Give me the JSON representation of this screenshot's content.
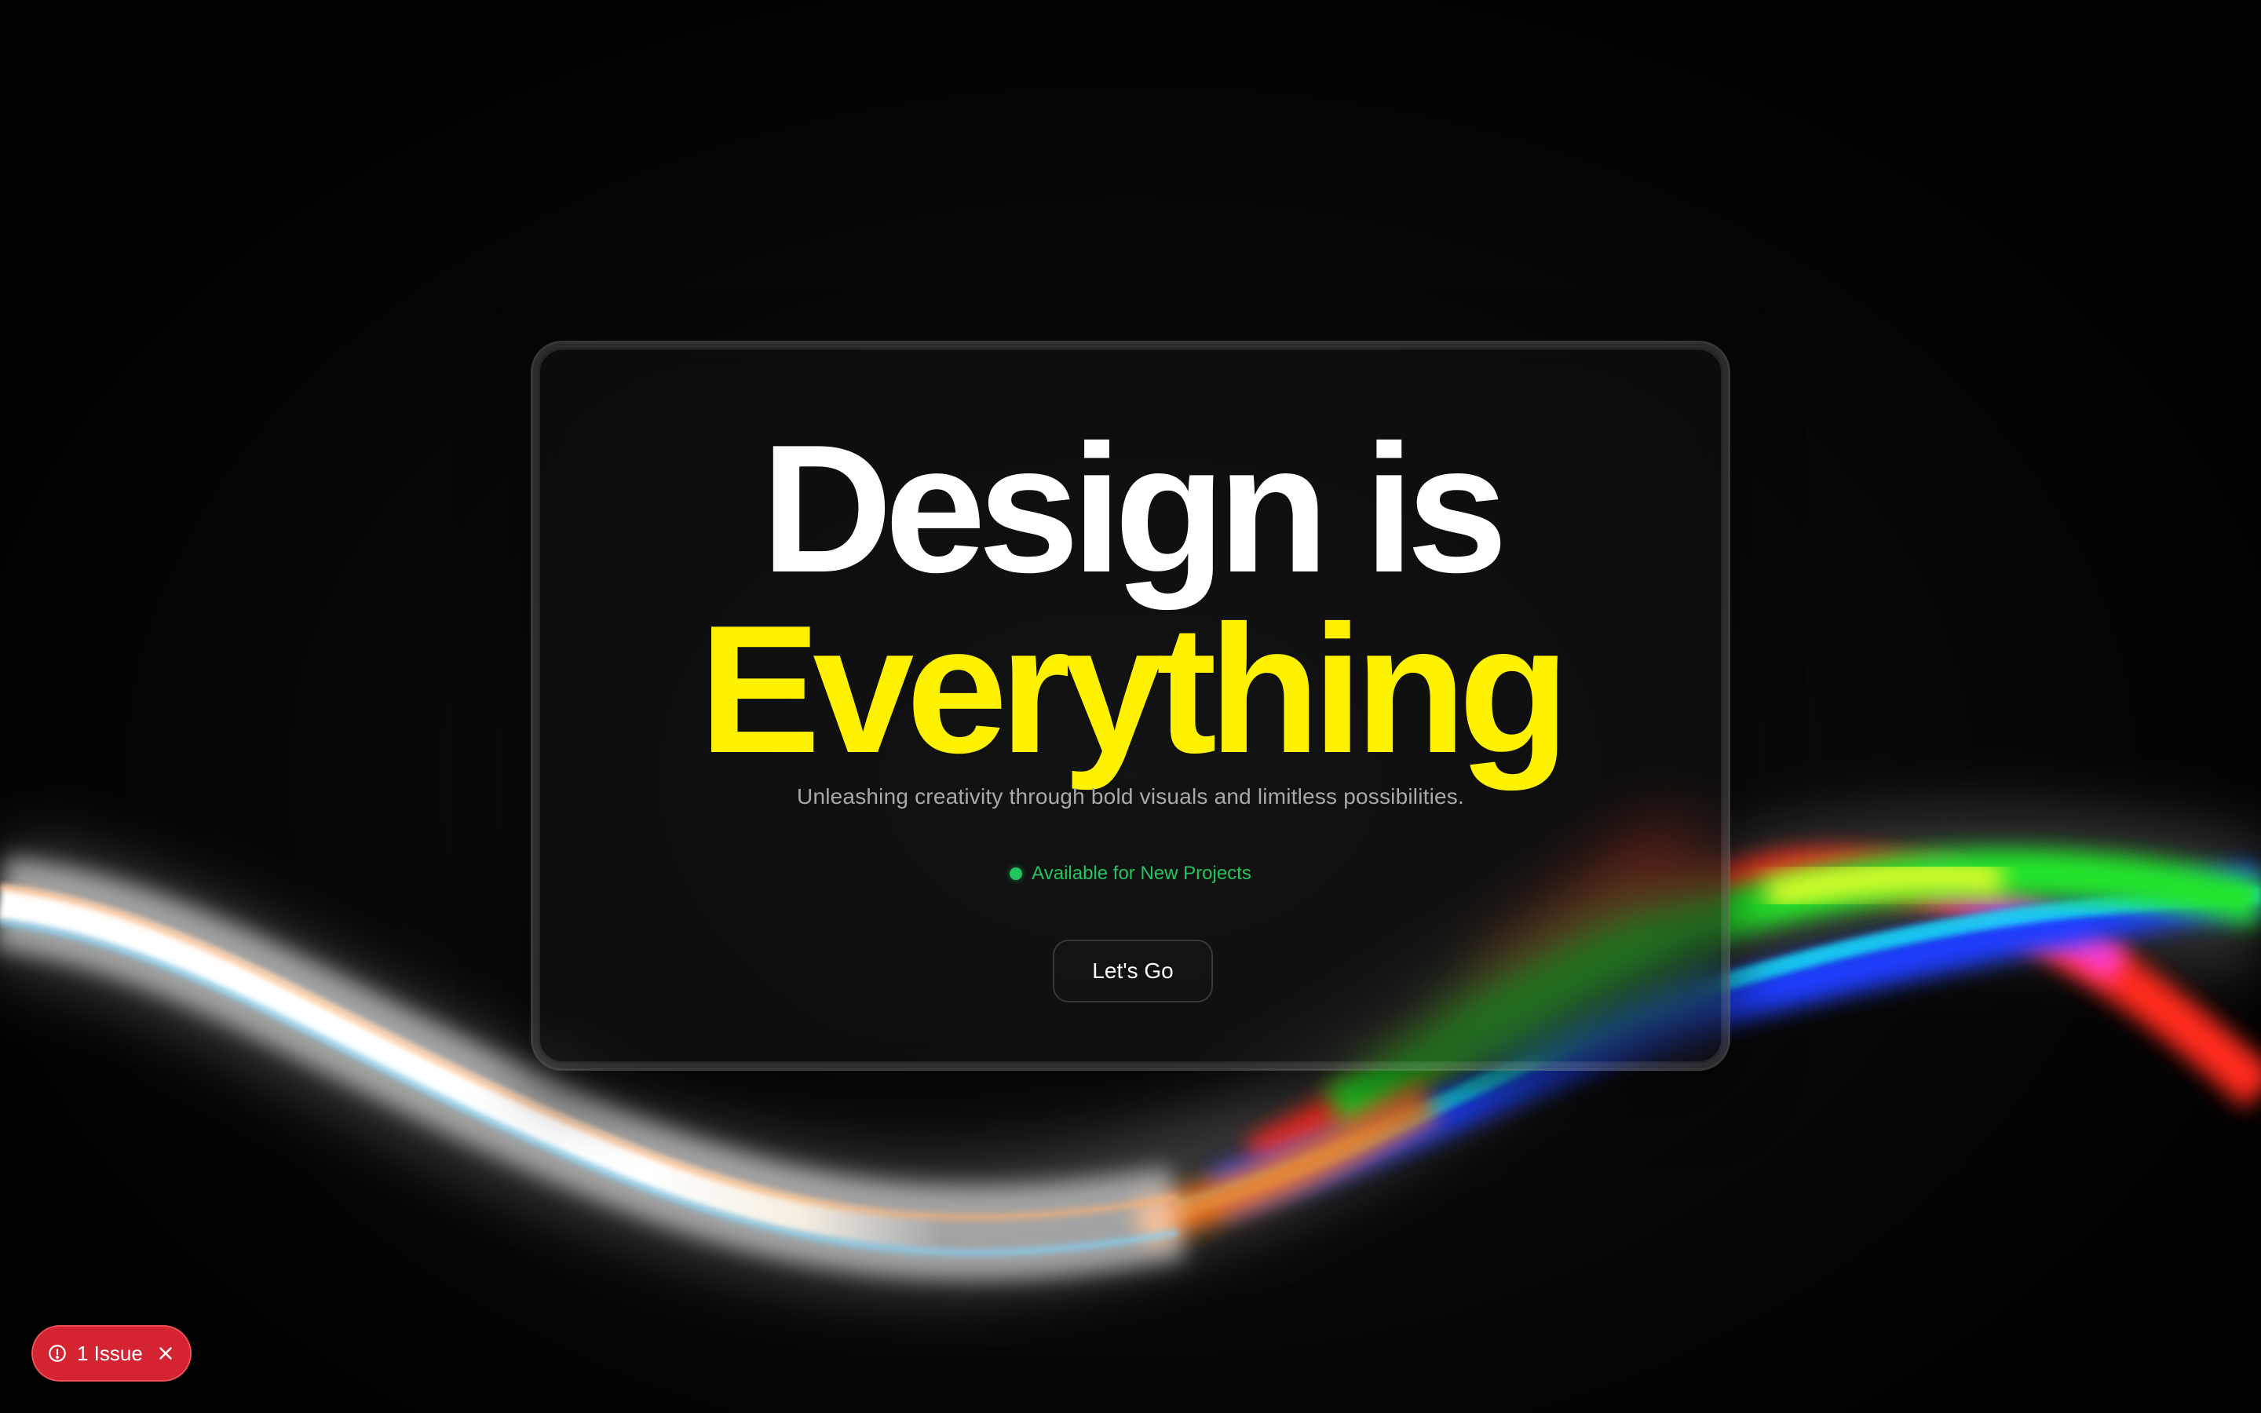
{
  "hero": {
    "title_line1": "Design is",
    "title_line2": "Everything",
    "subtitle": "Unleashing creativity through bold visuals and limitless possibilities.",
    "status_text": "Available for New Projects",
    "cta_label": "Let's Go"
  },
  "colors": {
    "accent_yellow": "#fff200",
    "status_green": "#22c55e",
    "issue_red": "#d42432"
  },
  "dev_overlay": {
    "issue_label": "1 Issue",
    "issue_icon": "alert-circle-icon",
    "close_icon": "close-icon"
  }
}
